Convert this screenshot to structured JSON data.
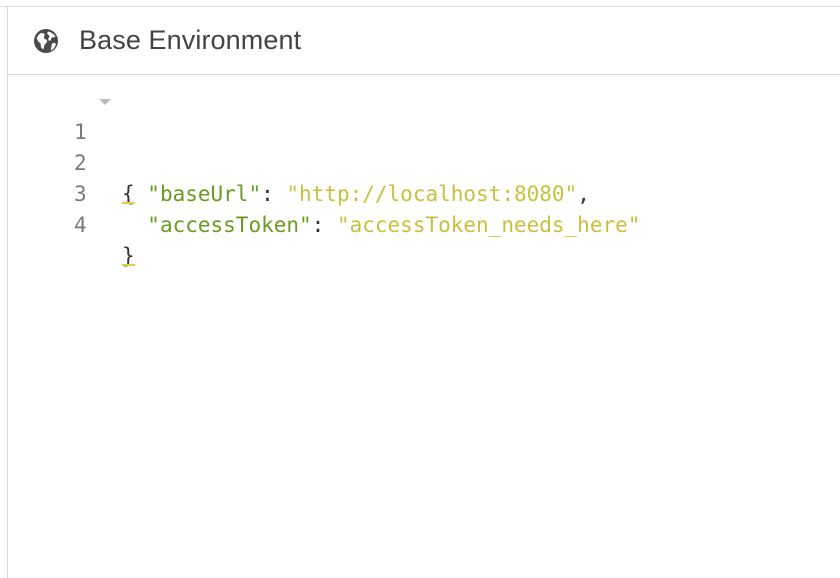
{
  "header": {
    "title": "Base Environment",
    "icon": "globe-icon"
  },
  "editor": {
    "line_numbers": [
      "1",
      "2",
      "3",
      "4"
    ],
    "open_brace": "{",
    "close_brace": "}",
    "indent": "  ",
    "colon": ": ",
    "comma": ",",
    "entries": [
      {
        "key": "\"baseUrl\"",
        "value": "\"http://localhost:8080\""
      },
      {
        "key": "\"accessToken\"",
        "value": "\"accessToken_needs_here\""
      }
    ]
  },
  "colors": {
    "key": "#6a9a1f",
    "string": "#c9c13c",
    "brace_underline": "#e6c84e",
    "line_number": "#7a7a7a"
  }
}
